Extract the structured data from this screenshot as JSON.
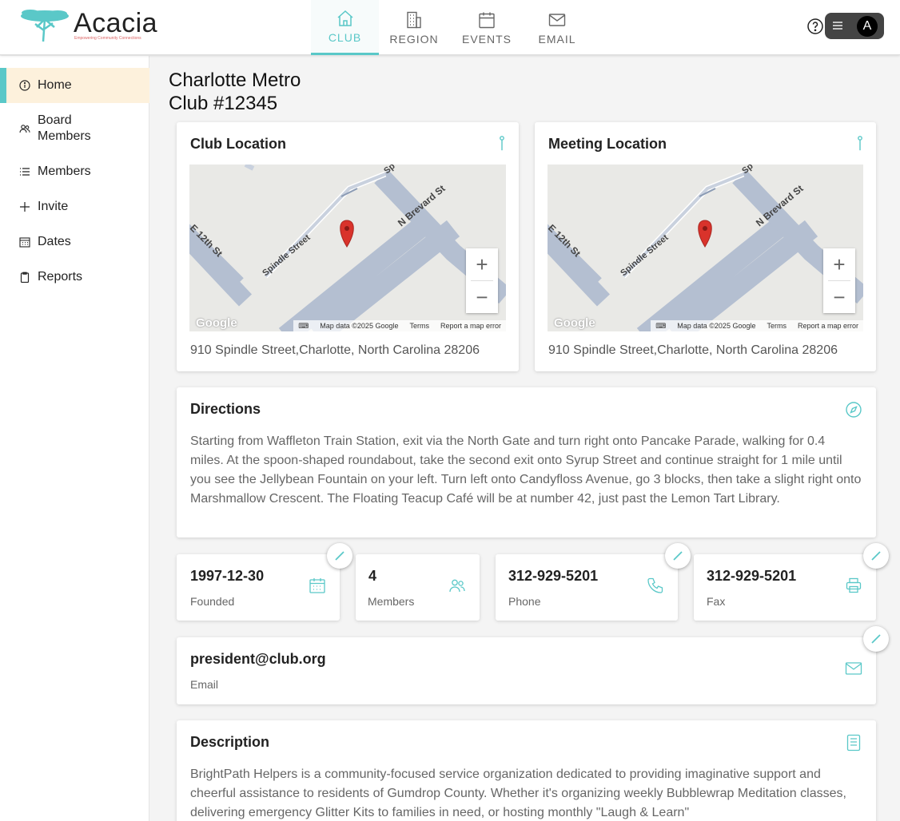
{
  "brand": {
    "name": "Acacia",
    "tagline": "Empowering Community Connections",
    "accent": "#5ac8c8"
  },
  "nav": {
    "tabs": [
      {
        "label": "CLUB",
        "icon": "home-icon",
        "active": true
      },
      {
        "label": "REGION",
        "icon": "building-icon"
      },
      {
        "label": "EVENTS",
        "icon": "calendar-icon"
      },
      {
        "label": "EMAIL",
        "icon": "mail-icon"
      }
    ],
    "avatar_initial": "A"
  },
  "sidebar": {
    "items": [
      {
        "label": "Home",
        "icon": "info-icon",
        "active": true
      },
      {
        "label": "Board Members",
        "icon": "people-icon"
      },
      {
        "label": "Members",
        "icon": "list-icon"
      },
      {
        "label": "Invite",
        "icon": "plus-icon"
      },
      {
        "label": "Dates",
        "icon": "calendar-icon"
      },
      {
        "label": "Reports",
        "icon": "clipboard-icon"
      }
    ]
  },
  "club": {
    "name": "Charlotte Metro",
    "number": "Club #12345"
  },
  "club_location": {
    "title": "Club Location",
    "address": "910 Spindle Street,Charlotte, North Carolina 28206"
  },
  "meeting_location": {
    "title": "Meeting Location",
    "address": "910 Spindle Street,Charlotte, North Carolina 28206"
  },
  "map": {
    "streets": [
      "Spindle Street",
      "N Brevard St",
      "E 12th St",
      "Sp"
    ],
    "logo": "Google",
    "attribution": "Map data ©2025 Google",
    "terms": "Terms",
    "report": "Report a map error",
    "zoom_in": "+",
    "zoom_out": "−"
  },
  "directions": {
    "title": "Directions",
    "text": "Starting from Waffleton Train Station, exit via the North Gate and turn right onto Pancake Parade, walking for 0.4 miles. At the spoon-shaped roundabout, take the second exit onto Syrup Street and continue straight for 1 mile until you see the Jellybean Fountain on your left. Turn left onto Candyfloss Avenue, go 3 blocks, then take a slight right onto Marshmallow Crescent. The Floating Teacup Café will be at number 42, just past the Lemon Tart Library."
  },
  "stats": {
    "founded": {
      "value": "1997-12-30",
      "label": "Founded"
    },
    "members": {
      "value": "4",
      "label": "Members"
    },
    "phone": {
      "value": "312-929-5201",
      "label": "Phone"
    },
    "fax": {
      "value": "312-929-5201",
      "label": "Fax"
    },
    "email": {
      "value": "president@club.org",
      "label": "Email"
    }
  },
  "description": {
    "title": "Description",
    "text": "BrightPath Helpers is a community-focused service organization dedicated to providing imaginative support and cheerful assistance to residents of Gumdrop County. Whether it's organizing weekly Bubblewrap Meditation classes, delivering emergency Glitter Kits to families in need, or hosting monthly \"Laugh & Learn\""
  }
}
